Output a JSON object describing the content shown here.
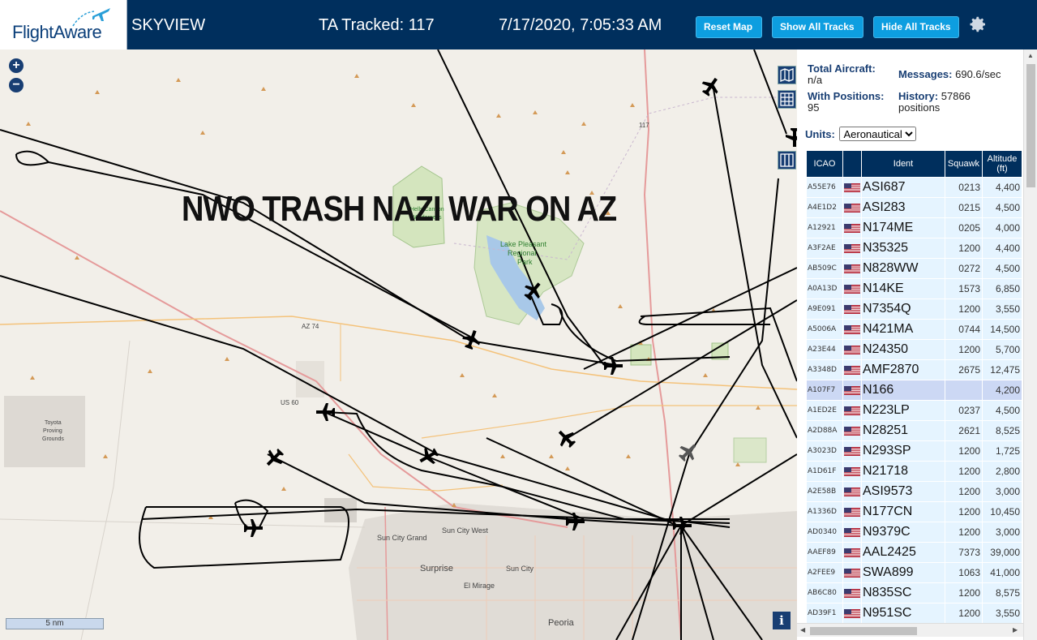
{
  "header": {
    "logo_text": "FlightAware",
    "site_name": "SKYVIEW",
    "ta_tracked": "TA Tracked: 117",
    "clock": "7/17/2020, 7:05:33 AM",
    "buttons": {
      "reset": "Reset Map",
      "show_all": "Show All Tracks",
      "hide_all": "Hide All Tracks"
    }
  },
  "map": {
    "overlay_text": "NWO TRASH NAZI WAR ON AZ",
    "scale": "5 nm",
    "zoom_in": "+",
    "zoom_out": "−",
    "info": "i",
    "labels": {
      "lake": "Lake Pleasant",
      "lake2": "Regional",
      "lake3": "Park",
      "wild1": "Hells Canyon",
      "wild2": "Wilderness",
      "toyota1": "Toyota",
      "toyota2": "Proving",
      "toyota3": "Grounds",
      "az74": "AZ 74",
      "us60": "US 60",
      "suncitygrand": "Sun City Grand",
      "suncitywest": "Sun City West",
      "suncity": "Sun City",
      "surprise": "Surprise",
      "elmirage": "El Mirage",
      "peoria": "Peoria",
      "r17": "117"
    },
    "colors": {
      "land": "#f2efe9",
      "park": "#cde3b4",
      "water": "#a8c8e8",
      "urban": "#e0dcd6",
      "road_major": "#e59a9a",
      "road_orange": "#f4c27a",
      "track": "#000000"
    }
  },
  "sidebar": {
    "total_label": "Total Aircraft:",
    "total_value": "n/a",
    "positions_label": "With Positions:",
    "positions_value": "95",
    "messages_label": "Messages:",
    "messages_value": "690.6/sec",
    "history_label": "History:",
    "history_value": "57866 positions",
    "units_label": "Units:",
    "units_value": "Aeronautical",
    "columns": {
      "icao": "ICAO",
      "ident": "Ident",
      "squawk": "Squawk",
      "altitude": "Altitude (ft)"
    },
    "rows": [
      {
        "icao": "A55E76",
        "ident": "ASI687",
        "squawk": "0213",
        "alt": "4,400"
      },
      {
        "icao": "A4E1D2",
        "ident": "ASI283",
        "squawk": "0215",
        "alt": "4,500"
      },
      {
        "icao": "A12921",
        "ident": "N174ME",
        "squawk": "0205",
        "alt": "4,000"
      },
      {
        "icao": "A3F2AE",
        "ident": "N35325",
        "squawk": "1200",
        "alt": "4,400"
      },
      {
        "icao": "AB509C",
        "ident": "N828WW",
        "squawk": "0272",
        "alt": "4,500"
      },
      {
        "icao": "A0A13D",
        "ident": "N14KE",
        "squawk": "1573",
        "alt": "6,850"
      },
      {
        "icao": "A9E091",
        "ident": "N7354Q",
        "squawk": "1200",
        "alt": "3,550"
      },
      {
        "icao": "A5006A",
        "ident": "N421MA",
        "squawk": "0744",
        "alt": "14,500"
      },
      {
        "icao": "A23E44",
        "ident": "N24350",
        "squawk": "1200",
        "alt": "5,700"
      },
      {
        "icao": "A3348D",
        "ident": "AMF2870",
        "squawk": "2675",
        "alt": "12,475"
      },
      {
        "icao": "A107F7",
        "ident": "N166",
        "squawk": "",
        "alt": "4,200"
      },
      {
        "icao": "A1ED2E",
        "ident": "N223LP",
        "squawk": "0237",
        "alt": "4,500"
      },
      {
        "icao": "A2D88A",
        "ident": "N28251",
        "squawk": "2621",
        "alt": "8,525"
      },
      {
        "icao": "A3023D",
        "ident": "N293SP",
        "squawk": "1200",
        "alt": "1,725"
      },
      {
        "icao": "A1D61F",
        "ident": "N21718",
        "squawk": "1200",
        "alt": "2,800"
      },
      {
        "icao": "A2E58B",
        "ident": "ASI9573",
        "squawk": "1200",
        "alt": "3,000"
      },
      {
        "icao": "A1336D",
        "ident": "N177CN",
        "squawk": "1200",
        "alt": "10,450"
      },
      {
        "icao": "AD0340",
        "ident": "N9379C",
        "squawk": "1200",
        "alt": "3,000"
      },
      {
        "icao": "AAEF89",
        "ident": "AAL2425",
        "squawk": "7373",
        "alt": "39,000"
      },
      {
        "icao": "A2FEE9",
        "ident": "SWA899",
        "squawk": "1063",
        "alt": "41,000"
      },
      {
        "icao": "AB6C80",
        "ident": "N835SC",
        "squawk": "1200",
        "alt": "8,575"
      },
      {
        "icao": "AD39F1",
        "ident": "N951SC",
        "squawk": "1200",
        "alt": "3,550"
      }
    ],
    "selected_row": 10
  }
}
